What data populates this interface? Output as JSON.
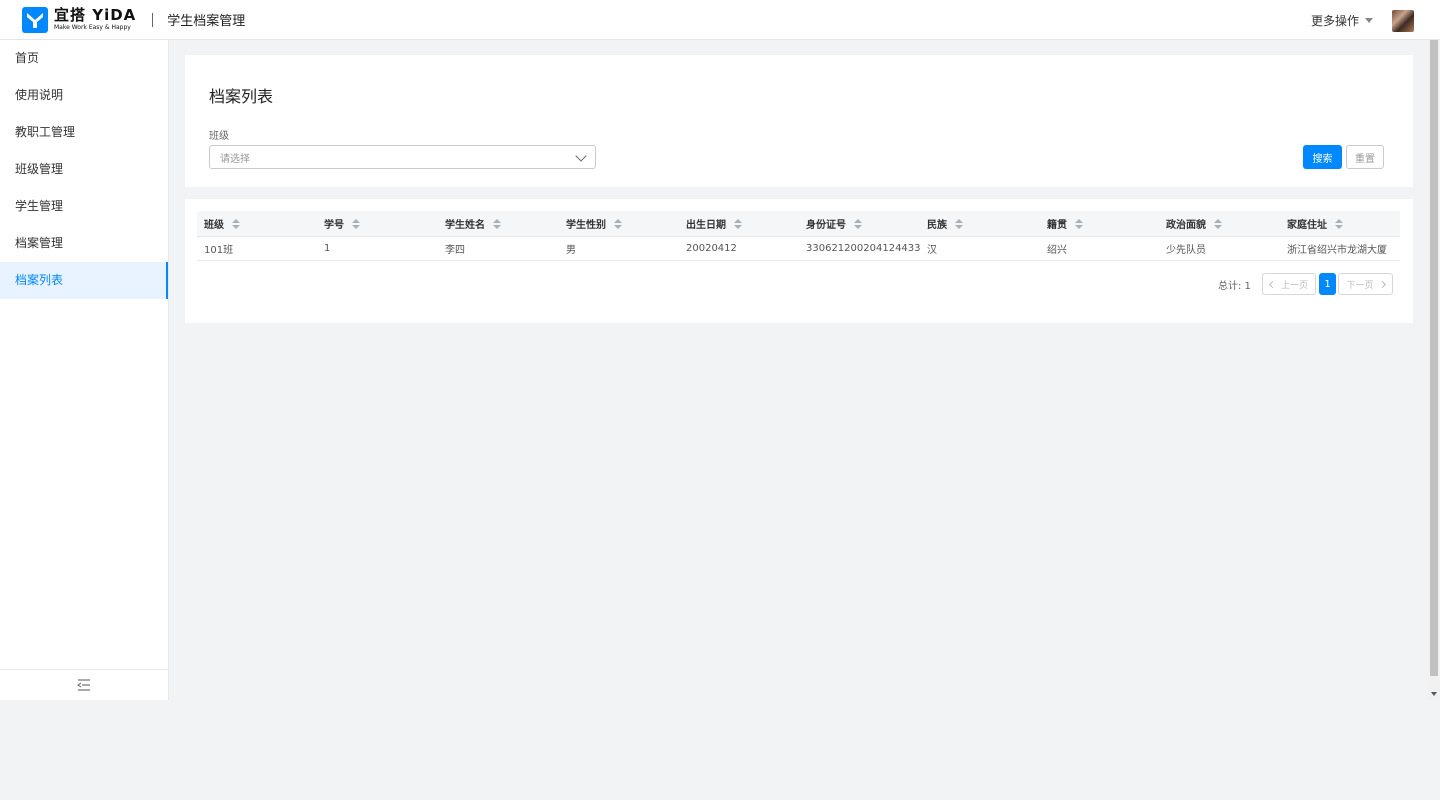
{
  "header": {
    "logo_main": "宜搭 YiDA",
    "logo_sub": "Make Work Easy & Happy",
    "app_title": "学生档案管理",
    "more_ops": "更多操作"
  },
  "sidebar": {
    "items": [
      {
        "label": "首页"
      },
      {
        "label": "使用说明"
      },
      {
        "label": "教职工管理"
      },
      {
        "label": "班级管理"
      },
      {
        "label": "学生管理"
      },
      {
        "label": "档案管理"
      },
      {
        "label": "档案列表",
        "active": true
      }
    ],
    "collapse_icon": "collapse-menu-icon"
  },
  "search": {
    "title": "档案列表",
    "class_label": "班级",
    "class_placeholder": "请选择",
    "search_button": "搜索",
    "reset_button": "重置"
  },
  "table": {
    "columns": [
      "班级",
      "学号",
      "学生姓名",
      "学生性别",
      "出生日期",
      "身份证号",
      "民族",
      "籍贯",
      "政治面貌",
      "家庭住址"
    ],
    "rows": [
      [
        "101班",
        "1",
        "李四",
        "男",
        "20020412",
        "330621200204124433",
        "汉",
        "绍兴",
        "少先队员",
        "浙江省绍兴市龙湖大厦"
      ]
    ]
  },
  "pagination": {
    "total_text": "总计: 1",
    "prev_label": "上一页",
    "next_label": "下一页",
    "current_page": "1"
  },
  "colors": {
    "accent": "#0089ff",
    "background": "#f2f3f5",
    "active_bg": "#e8f3ff"
  }
}
